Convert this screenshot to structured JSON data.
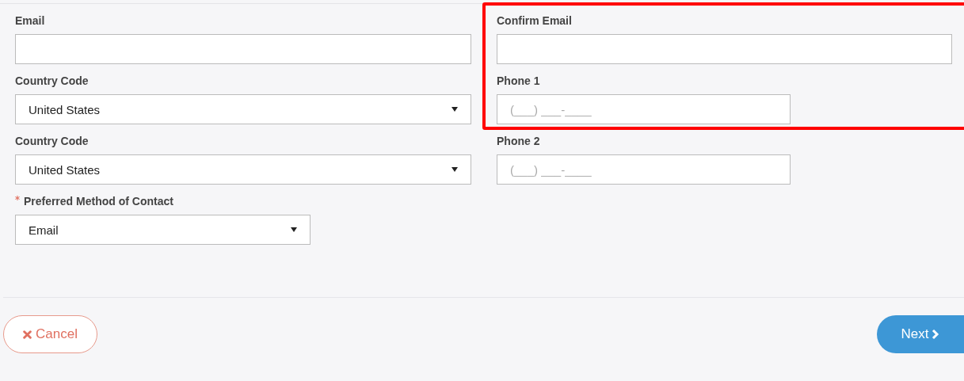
{
  "rows": [
    [
      {
        "label": "Email",
        "kind": "text",
        "required": false
      },
      {
        "label": "Confirm Email",
        "kind": "text",
        "required": false
      }
    ],
    [
      {
        "label": "Country Code",
        "kind": "select",
        "value": "United States",
        "required": false
      },
      {
        "label": "Phone 1",
        "kind": "phone",
        "placeholder": "(___) ___-____",
        "required": false
      }
    ],
    [
      {
        "label": "Country Code",
        "kind": "select",
        "value": "United States",
        "required": false
      },
      {
        "label": "Phone 2",
        "kind": "phone",
        "placeholder": "(___) ___-____",
        "required": false
      }
    ],
    [
      {
        "label": "Preferred Method of Contact",
        "kind": "short-select",
        "value": "Email",
        "required": true
      }
    ]
  ],
  "buttons": {
    "cancel": "Cancel",
    "next": "Next"
  }
}
